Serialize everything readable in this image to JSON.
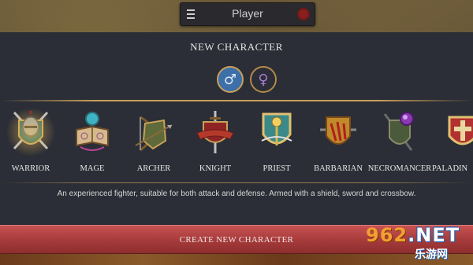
{
  "header": {
    "title": "Player"
  },
  "panel": {
    "title": "NEW CHARACTER",
    "gender": {
      "male_symbol": "♂",
      "female_symbol": "♀",
      "selected": "male"
    }
  },
  "classes": [
    {
      "name": "WARRIOR",
      "icon": "warrior-helmet-shield-icon",
      "selected": true
    },
    {
      "name": "MAGE",
      "icon": "mage-spellbook-icon",
      "selected": false
    },
    {
      "name": "ARCHER",
      "icon": "archer-bow-icon",
      "selected": false
    },
    {
      "name": "KNIGHT",
      "icon": "knight-sword-shield-icon",
      "selected": false
    },
    {
      "name": "PRIEST",
      "icon": "priest-staff-shield-icon",
      "selected": false
    },
    {
      "name": "BARBARIAN",
      "icon": "barbarian-claw-shield-icon",
      "selected": false
    },
    {
      "name": "NECROMANCER",
      "icon": "necromancer-orb-icon",
      "selected": false
    },
    {
      "name": "PALADIN",
      "icon": "paladin-crest-icon",
      "selected": false
    }
  ],
  "description": "An experienced fighter, suitable for both attack and defense. Armed with a shield, sword and crossbow.",
  "actions": {
    "create_label": "CREATE NEW CHARACTER"
  },
  "watermark": {
    "main_a": "962",
    "main_b": ".NET",
    "sub": "乐游网"
  },
  "colors": {
    "accent_gold": "#c9a05a",
    "button_red": "#a53a3a",
    "panel": "#2b2e36"
  }
}
